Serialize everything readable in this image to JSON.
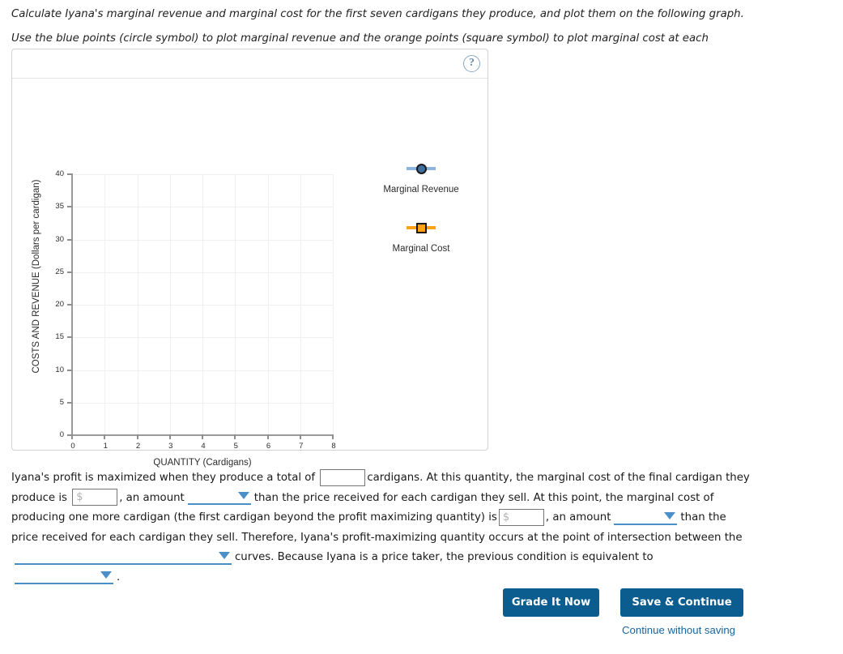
{
  "instructions": "Calculate Iyana's marginal revenue and marginal cost for the first seven cardigans they produce, and plot them on the following graph. Use the blue points (circle symbol) to plot marginal revenue and the orange points (square symbol) to plot marginal cost at each quantity.",
  "panel": {
    "help_icon": "question-mark-icon",
    "help_label": "?"
  },
  "chart_data": {
    "type": "scatter",
    "title": "",
    "xlabel": "QUANTITY (Cardigans)",
    "ylabel": "COSTS AND REVENUE (Dollars per cardigan)",
    "xlim": [
      0,
      8
    ],
    "ylim": [
      0,
      40
    ],
    "xticks": [
      0,
      1,
      2,
      3,
      4,
      5,
      6,
      7,
      8
    ],
    "yticks": [
      0,
      5,
      10,
      15,
      20,
      25,
      30,
      35,
      40
    ],
    "grid": true,
    "legend_position": "right",
    "series": [
      {
        "name": "Marginal Revenue",
        "marker": "circle",
        "color": "#3f6f9f",
        "line_color": "#8cb4dc",
        "x": [],
        "values": []
      },
      {
        "name": "Marginal Cost",
        "marker": "square",
        "color": "#ffa314",
        "line_color": "#ffa314",
        "x": [],
        "values": []
      }
    ]
  },
  "question": {
    "seg1": "Iyana's profit is maximized when they produce a total of ",
    "qty_input_value": "",
    "qty_input_placeholder": "",
    "seg2": "cardigans. At this quantity, the marginal cost of the final cardigan they produce is",
    "mc_input_value": "",
    "mc_input_placeholder": "$",
    "seg3": ", an amount",
    "dropdown1_value": "",
    "seg4": "than the price received for each cardigan they sell. At this point, the marginal cost of producing one more",
    "seg5": "cardigan (the first cardigan beyond the profit maximizing quantity) is",
    "mc2_input_value": "",
    "mc2_input_placeholder": "$",
    "seg6": ", an amount",
    "dropdown2_value": "",
    "seg7": "than the price received for each cardigan",
    "seg8": "they sell. Therefore, Iyana's profit-maximizing quantity occurs at the point of intersection between the",
    "dropdown3_value": "",
    "seg9": "curves. Because Iyana is a price taker, the previous condition is equivalent to",
    "dropdown4_value": "",
    "seg10": "."
  },
  "footer": {
    "grade_label": "Grade It Now",
    "save_label": "Save & Continue",
    "continue_label": "Continue without saving"
  },
  "colors": {
    "button_blue": "#0b5c8f",
    "link_blue": "#1565a0",
    "dropdown_blue": "#4b8fc8",
    "marginal_revenue": "#3f6f9f",
    "marginal_cost": "#ffa314"
  }
}
